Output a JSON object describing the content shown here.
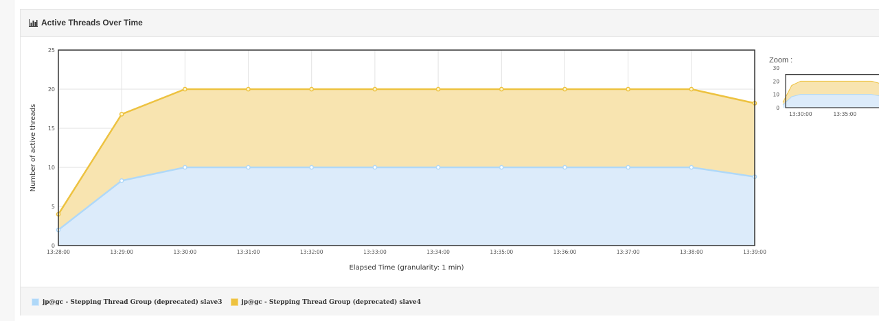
{
  "panel": {
    "title": "Active Threads Over Time",
    "title_icon": "bar-chart-icon"
  },
  "zoom": {
    "label": "Zoom :"
  },
  "colors": {
    "series1_fill": "#dcebfa",
    "series1_line": "#afd8f8",
    "series1_swatch": "#afd8f8",
    "series2_fill": "#f8e4b0",
    "series2_line": "#edc240",
    "series2_swatch": "#edc240",
    "grid": "#e2e2e2",
    "axis": "#333333"
  },
  "chart_data": {
    "type": "area",
    "stacked": true,
    "xlabel": "Elapsed Time (granularity: 1 min)",
    "ylabel": "Number of active threads",
    "ylim": [
      0,
      25
    ],
    "yticks": [
      0,
      5,
      10,
      15,
      20,
      25
    ],
    "x": [
      "13:28:00",
      "13:29:00",
      "13:30:00",
      "13:31:00",
      "13:32:00",
      "13:33:00",
      "13:34:00",
      "13:35:00",
      "13:36:00",
      "13:37:00",
      "13:38:00",
      "13:39:00"
    ],
    "series": [
      {
        "name": "jp@gc - Stepping Thread Group (deprecated) slave3",
        "values": [
          2,
          8.3,
          10,
          10,
          10,
          10,
          10,
          10,
          10,
          10,
          10,
          8.8
        ]
      },
      {
        "name": "jp@gc - Stepping Thread Group (deprecated) slave4",
        "values": [
          2,
          8.5,
          10,
          10,
          10,
          10,
          10,
          10,
          10,
          10,
          10,
          9.4
        ]
      }
    ],
    "grid": true,
    "legend": "bottom",
    "overview": {
      "ylim": [
        0,
        30
      ],
      "yticks": [
        0,
        10,
        20,
        30
      ],
      "xticks": [
        "13:30:00",
        "13:35:00"
      ]
    }
  }
}
